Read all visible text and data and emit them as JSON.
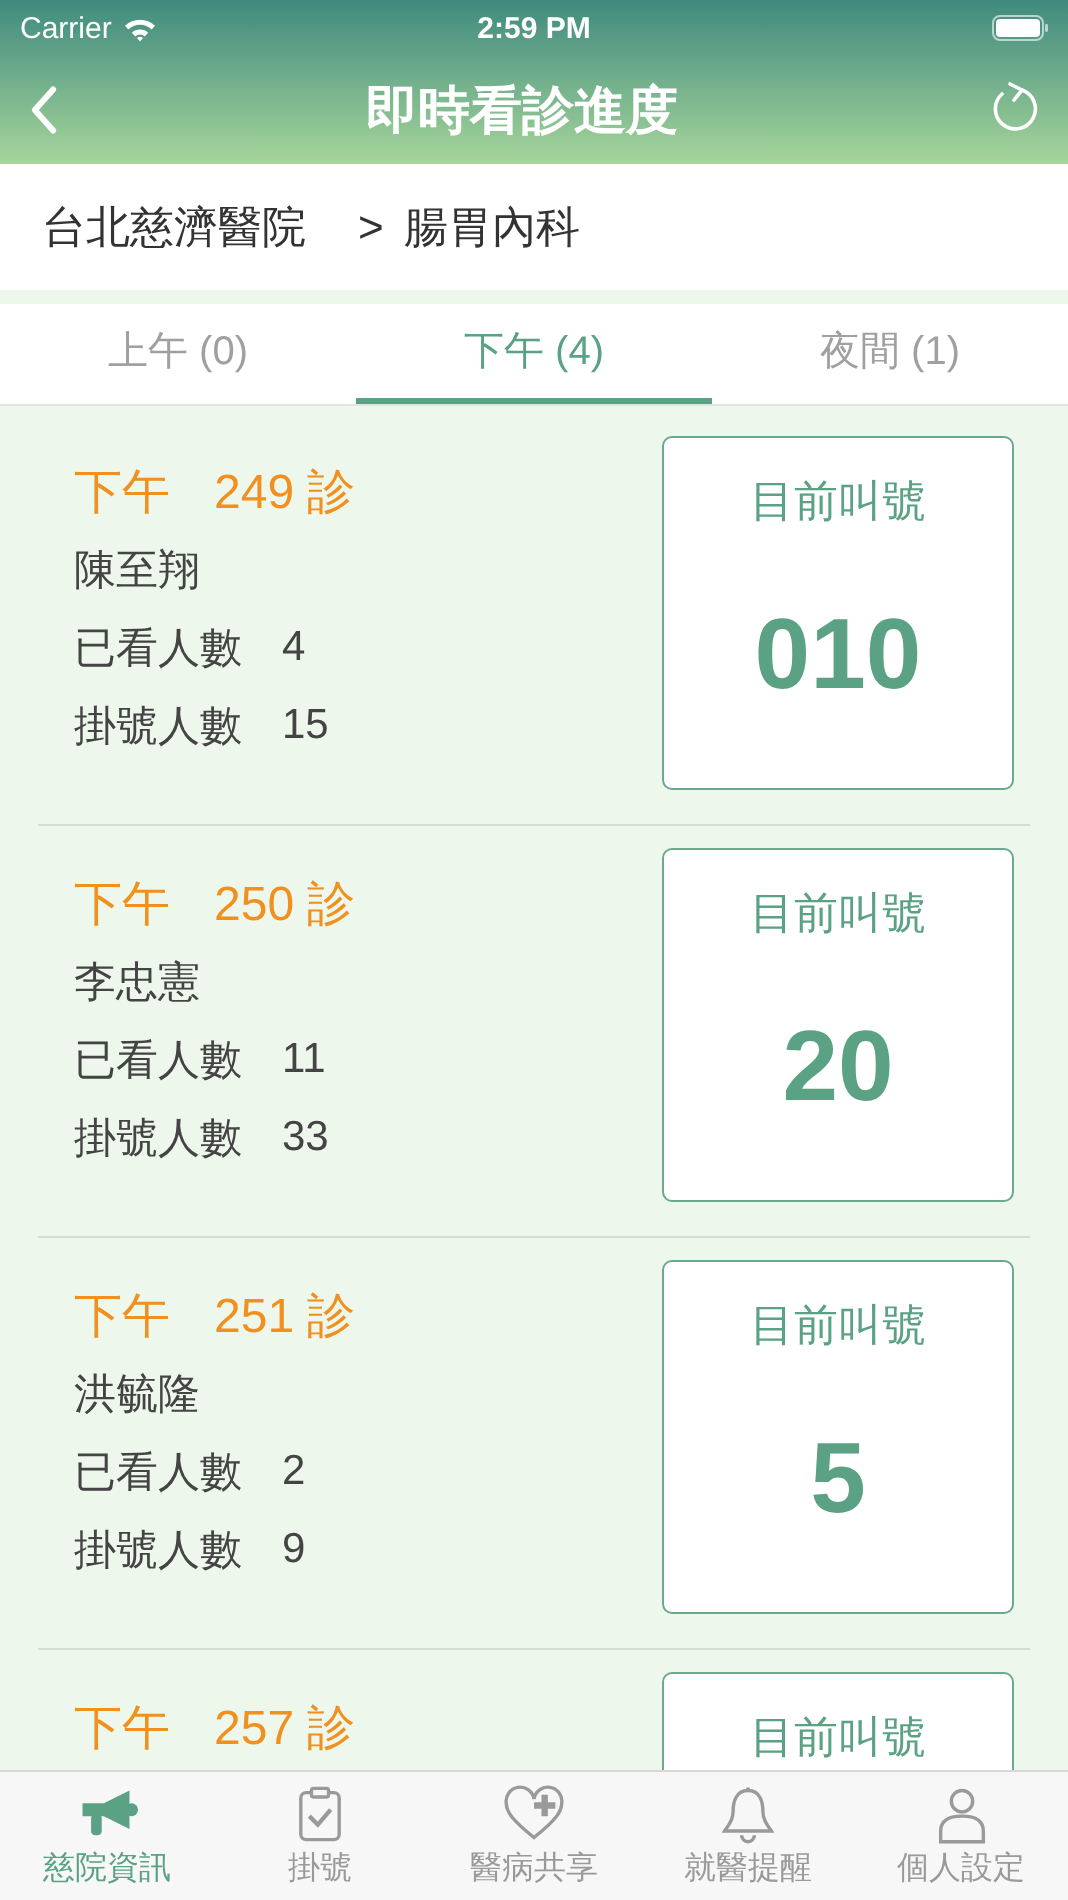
{
  "status_bar": {
    "carrier": "Carrier",
    "time": "2:59 PM"
  },
  "nav": {
    "title": "即時看診進度"
  },
  "breadcrumb": {
    "hospital": "台北慈濟醫院",
    "separator": ">",
    "department": "腸胃內科"
  },
  "tabs": [
    {
      "label": "上午 (0)",
      "selected": false
    },
    {
      "label": "下午 (4)",
      "selected": true
    },
    {
      "label": "夜間 (1)",
      "selected": false
    }
  ],
  "clinics": [
    {
      "session": "下午",
      "room": "249 診",
      "doctor": "陳至翔",
      "seen_label": "已看人數",
      "seen": "4",
      "registered_label": "掛號人數",
      "registered": "15",
      "call_label": "目前叫號",
      "call_number": "010"
    },
    {
      "session": "下午",
      "room": "250 診",
      "doctor": "李忠憲",
      "seen_label": "已看人數",
      "seen": "11",
      "registered_label": "掛號人數",
      "registered": "33",
      "call_label": "目前叫號",
      "call_number": "20"
    },
    {
      "session": "下午",
      "room": "251 診",
      "doctor": "洪毓隆",
      "seen_label": "已看人數",
      "seen": "2",
      "registered_label": "掛號人數",
      "registered": "9",
      "call_label": "目前叫號",
      "call_number": "5"
    },
    {
      "session": "下午",
      "room": "257 診",
      "call_label": "目前叫號"
    }
  ],
  "tab_bar": [
    {
      "kind": "megaphone",
      "label": "慈院資訊",
      "selected": true
    },
    {
      "kind": "clipboard",
      "label": "掛號",
      "selected": false
    },
    {
      "kind": "heart",
      "label": "醫病共享",
      "selected": false
    },
    {
      "kind": "bell",
      "label": "就醫提醒",
      "selected": false
    },
    {
      "kind": "person",
      "label": "個人設定",
      "selected": false
    }
  ]
}
